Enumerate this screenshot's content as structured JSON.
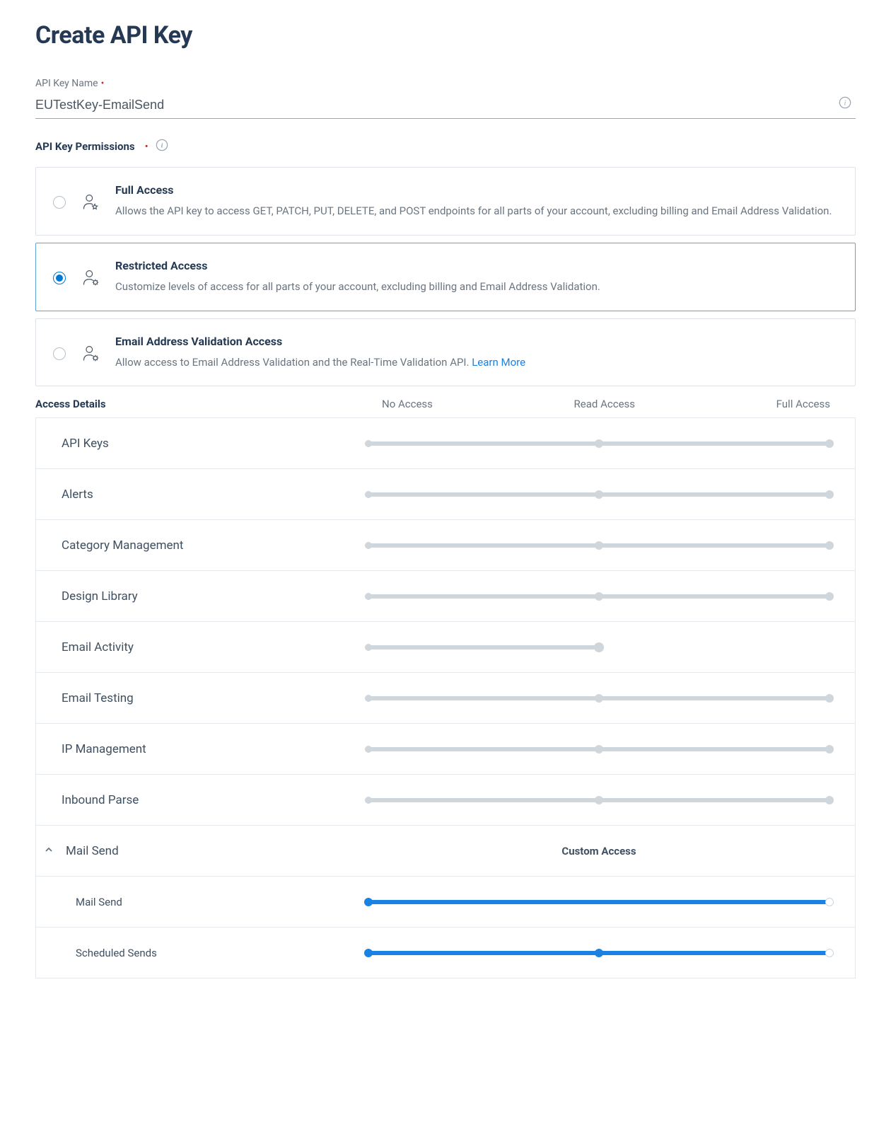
{
  "page_title": "Create API Key",
  "name_field": {
    "label": "API Key Name",
    "value": "EUTestKey-EmailSend"
  },
  "permissions_label": "API Key Permissions",
  "options": [
    {
      "id": "full",
      "title": "Full Access",
      "desc": "Allows the API key to access GET, PATCH, PUT, DELETE, and POST endpoints for all parts of your account, excluding billing and Email Address Validation.",
      "selected": false
    },
    {
      "id": "restricted",
      "title": "Restricted Access",
      "desc": "Customize levels of access for all parts of your account, excluding billing and Email Address Validation.",
      "selected": true
    },
    {
      "id": "validation",
      "title": "Email Address Validation Access",
      "desc": "Allow access to Email Address Validation and the Real-Time Validation API. ",
      "link": "Learn More",
      "selected": false
    }
  ],
  "access": {
    "header": "Access Details",
    "cols": [
      "No Access",
      "Read Access",
      "Full Access"
    ],
    "custom_label": "Custom Access",
    "rows": [
      {
        "label": "API Keys",
        "stops": 3,
        "value": 0
      },
      {
        "label": "Alerts",
        "stops": 3,
        "value": 0
      },
      {
        "label": "Category Management",
        "stops": 3,
        "value": 0
      },
      {
        "label": "Design Library",
        "stops": 3,
        "value": 0
      },
      {
        "label": "Email Activity",
        "stops": 2,
        "value": 0
      },
      {
        "label": "Email Testing",
        "stops": 3,
        "value": 0
      },
      {
        "label": "IP Management",
        "stops": 3,
        "value": 0
      },
      {
        "label": "Inbound Parse",
        "stops": 3,
        "value": 0
      }
    ],
    "mail_send": {
      "label": "Mail Send",
      "expanded": true,
      "children": [
        {
          "label": "Mail Send",
          "blue_to": 100,
          "handle_at": 0
        },
        {
          "label": "Scheduled Sends",
          "blue_to": 100,
          "mid_blue": true,
          "handle_at": 0
        }
      ]
    }
  }
}
